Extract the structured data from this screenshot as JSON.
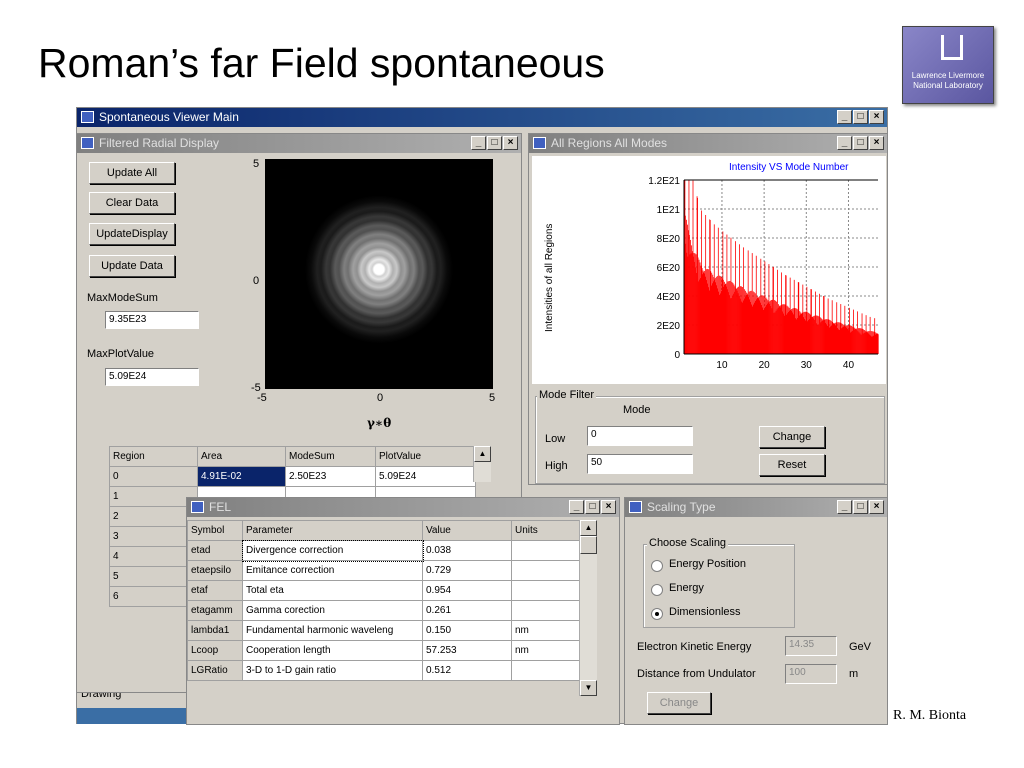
{
  "slide": {
    "title": "Roman’s far Field spontaneous",
    "author": "R. M. Bionta",
    "logo_line1": "Lawrence Livermore",
    "logo_line2": "National Laboratory"
  },
  "main_window": {
    "title": "Spontaneous Viewer Main",
    "status": "Drawing"
  },
  "radial": {
    "title": "Filtered Radial Display",
    "buttons": [
      "Update All",
      "Clear Data",
      "UpdateDisplay",
      "Update Data"
    ],
    "max_mode_sum_label": "MaxModeSum",
    "max_mode_sum_value": "9.35E23",
    "max_plot_label": "MaxPlotValue",
    "max_plot_value": "5.09E24",
    "y_ticks": [
      "5",
      "0",
      "-5"
    ],
    "x_ticks": [
      "-5",
      "0",
      "5"
    ],
    "xlabel": "γ∗θ",
    "table": {
      "headers": [
        "Region",
        "Area",
        "ModeSum",
        "PlotValue"
      ],
      "rows": [
        [
          "0",
          "4.91E-02",
          "2.50E23",
          "5.09E24"
        ],
        [
          "1"
        ],
        [
          "2"
        ],
        [
          "3"
        ],
        [
          "4"
        ],
        [
          "5"
        ],
        [
          "6"
        ]
      ]
    }
  },
  "modes": {
    "title": "All Regions All Modes",
    "mode_filter_label": "Mode Filter",
    "mode_label": "Mode",
    "low_label": "Low",
    "low_value": "0",
    "high_label": "High",
    "high_value": "50",
    "change_label": "Change",
    "reset_label": "Reset"
  },
  "chart_data": {
    "type": "bar",
    "title": "Intensity VS Mode Number",
    "xlabel": "",
    "ylabel": "Intensities of all Regions",
    "x_ticks": [
      "10",
      "20",
      "30",
      "40"
    ],
    "y_ticks": [
      "0",
      "2E20",
      "4E20",
      "6E20",
      "8E20",
      "1E21",
      "1.2E21"
    ],
    "xlim": [
      1,
      47
    ],
    "ylim": [
      0,
      1.2e+21
    ],
    "grid": true,
    "color": "#ff0000",
    "envelope_x": [
      1,
      2,
      3,
      4,
      5,
      8,
      10,
      15,
      20,
      25,
      30,
      35,
      40,
      45,
      47
    ],
    "envelope_y": [
      1e+21,
      8.5e+20,
      7.5e+20,
      6.8e+20,
      6.2e+20,
      5.6e+20,
      5.3e+20,
      4.6e+20,
      4e+20,
      3.4e+20,
      2.9e+20,
      2.4e+20,
      2e+20,
      1.6e+20,
      1.5e+20
    ]
  },
  "fel": {
    "title": "FEL",
    "headers": [
      "Symbol",
      "Parameter",
      "Value",
      "Units"
    ],
    "rows": [
      [
        "etad",
        "Divergence correction",
        "0.038",
        ""
      ],
      [
        "etaepsilo",
        "Emitance correction",
        "0.729",
        ""
      ],
      [
        "etaf",
        "Total eta",
        "0.954",
        ""
      ],
      [
        "etagamm",
        "Gamma corection",
        "0.261",
        ""
      ],
      [
        "lambda1",
        "Fundamental harmonic waveleng",
        "0.150",
        "nm"
      ],
      [
        "Lcoop",
        "Cooperation length",
        "57.253",
        "nm"
      ],
      [
        "LGRatio",
        "3-D to 1-D gain ratio",
        "0.512",
        ""
      ]
    ]
  },
  "scaling": {
    "title": "Scaling Type",
    "group_label": "Choose Scaling",
    "options": [
      "Energy Position",
      "Energy",
      "Dimensionless"
    ],
    "selected": 2,
    "energy_label": "Electron Kinetic Energy",
    "energy_value": "14.35",
    "energy_unit": "GeV",
    "distance_label": "Distance from Undulator",
    "distance_value": "100",
    "distance_unit": "m",
    "change_label": "Change"
  }
}
